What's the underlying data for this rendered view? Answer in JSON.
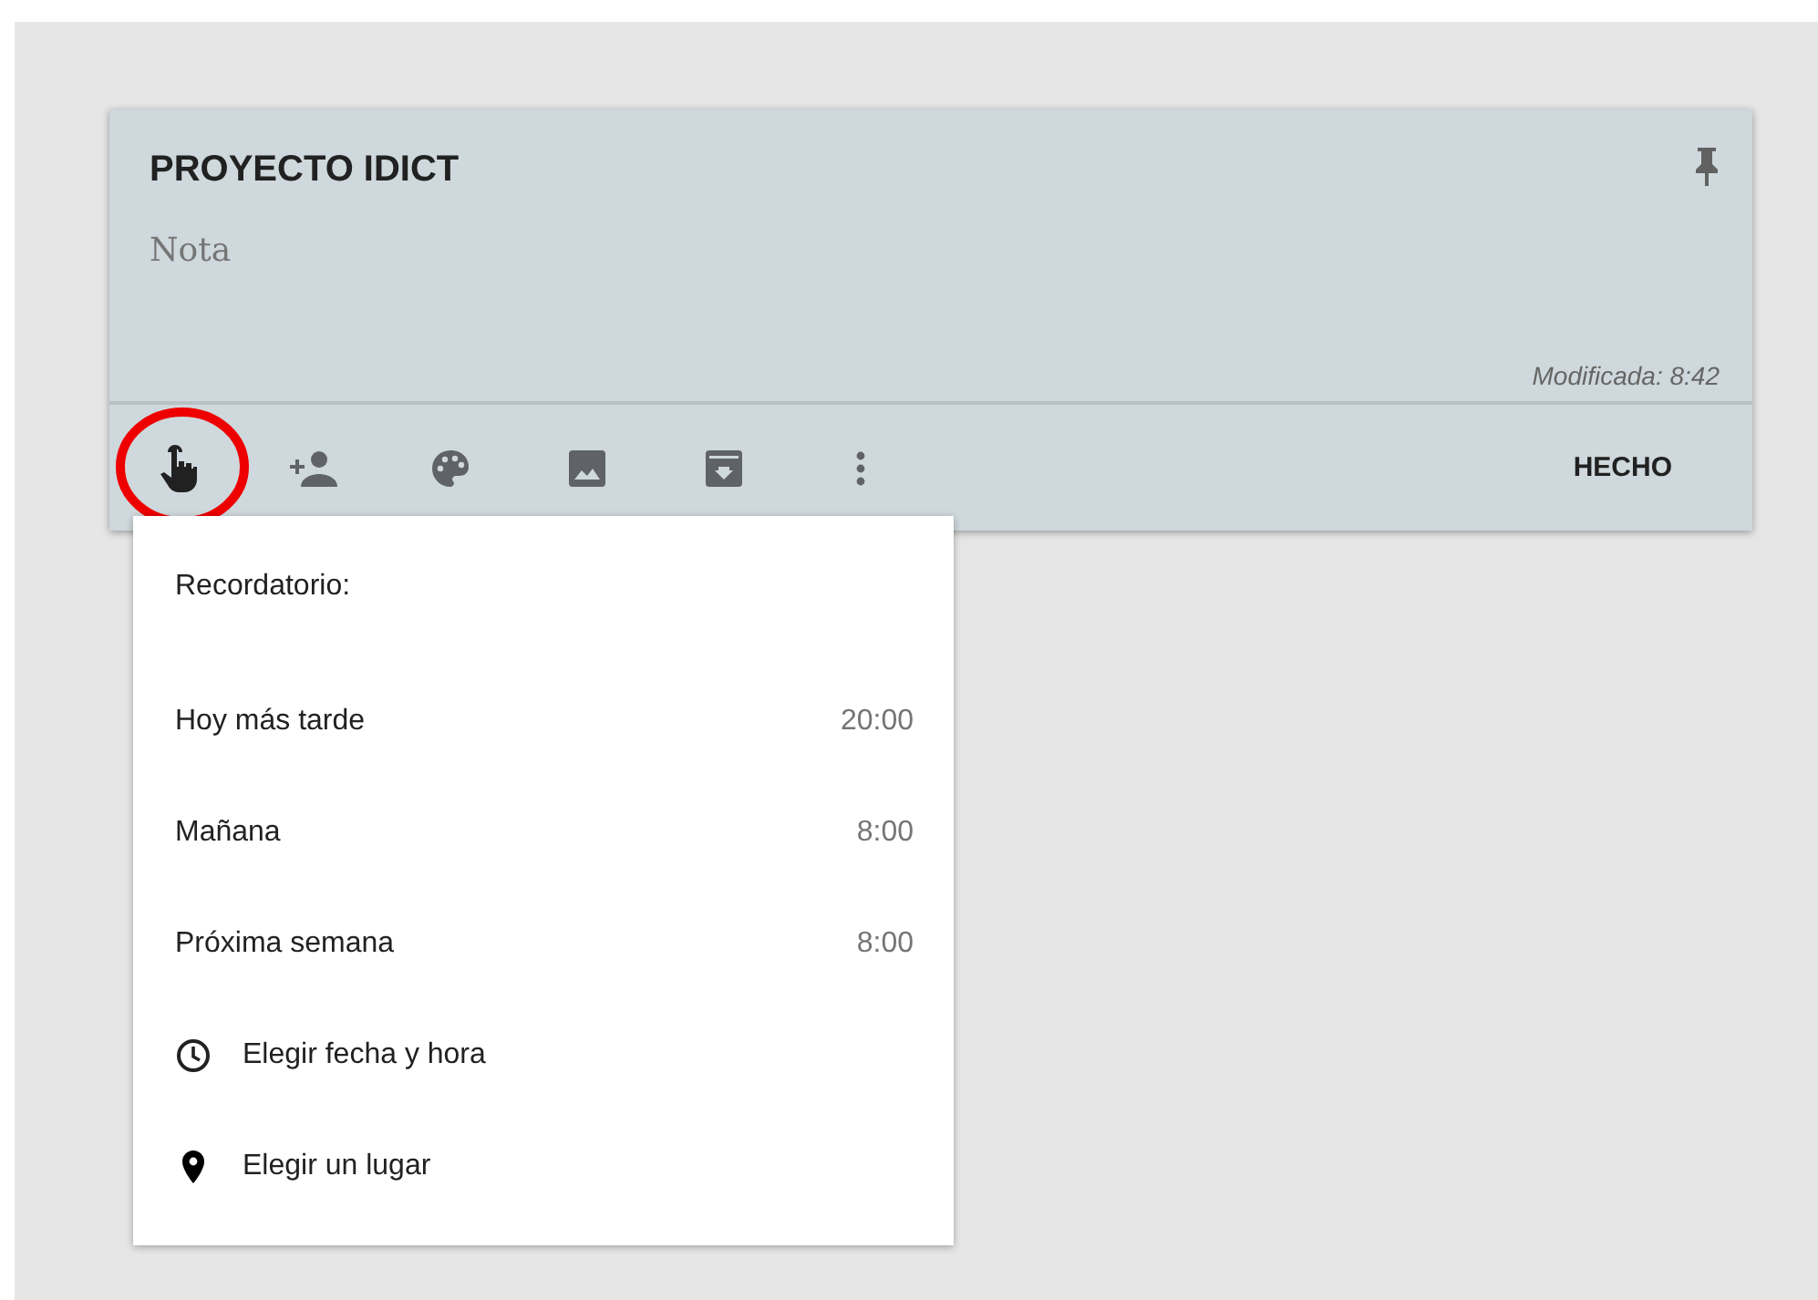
{
  "note": {
    "title": "PROYECTO IDICT",
    "placeholder": "Nota",
    "modified": "Modificada: 8:42",
    "pinned": true
  },
  "toolbar": {
    "done": "HECHO"
  },
  "reminder_menu": {
    "title": "Recordatorio:",
    "items": [
      {
        "kind": "preset",
        "label": "Hoy más tarde",
        "time": "20:00"
      },
      {
        "kind": "preset",
        "label": "Mañana",
        "time": "8:00"
      },
      {
        "kind": "preset",
        "label": "Próxima semana",
        "time": "8:00"
      },
      {
        "kind": "date",
        "label": "Elegir fecha y hora"
      },
      {
        "kind": "place",
        "label": "Elegir un lugar"
      }
    ]
  }
}
